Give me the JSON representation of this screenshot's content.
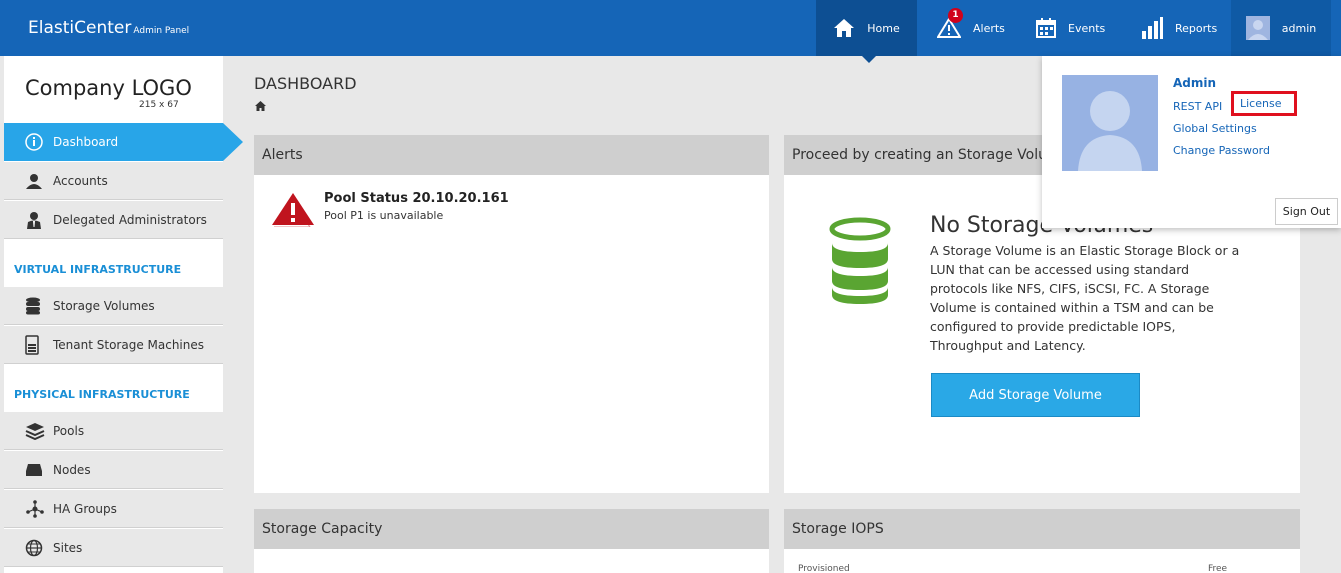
{
  "brand": {
    "name": "ElastiCenter",
    "sub": "Admin Panel"
  },
  "nav": {
    "home": "Home",
    "alerts": "Alerts",
    "alerts_badge": "1",
    "events": "Events",
    "reports": "Reports",
    "user": "admin"
  },
  "sidebar": {
    "logo": "Company LOGO",
    "logo_size": "215 x 67",
    "items": [
      {
        "label": "Dashboard",
        "icon": "info-icon"
      },
      {
        "label": "Accounts",
        "icon": "user-icon"
      },
      {
        "label": "Delegated Administrators",
        "icon": "admin-user-icon"
      }
    ],
    "virtual_section": "VIRTUAL INFRASTRUCTURE",
    "virtual_items": [
      {
        "label": "Storage Volumes",
        "icon": "database-icon"
      },
      {
        "label": "Tenant Storage Machines",
        "icon": "machine-icon"
      }
    ],
    "physical_section": "PHYSICAL INFRASTRUCTURE",
    "physical_items": [
      {
        "label": "Pools",
        "icon": "layers-icon"
      },
      {
        "label": "Nodes",
        "icon": "node-icon"
      },
      {
        "label": "HA Groups",
        "icon": "network-icon"
      },
      {
        "label": "Sites",
        "icon": "globe-icon"
      }
    ]
  },
  "page": {
    "title": "DASHBOARD"
  },
  "alerts_panel": {
    "title": "Alerts",
    "alert_title": "Pool Status 20.10.20.161",
    "alert_sub": "Pool P1 is unavailable"
  },
  "storage_panel": {
    "title": "Proceed by creating an Storage Volume",
    "heading": "No Storage Volumes",
    "description": "A Storage Volume is an Elastic Storage Block or a LUN that can be accessed using standard protocols like NFS, CIFS, iSCSI, FC. A Storage Volume is contained within a TSM and can be configured to provide predictable IOPS, Throughput and Latency.",
    "button": "Add Storage Volume"
  },
  "capacity_panel": {
    "title": "Storage Capacity"
  },
  "iops_panel": {
    "title": "Storage IOPS",
    "provisioned": "Provisioned",
    "free": "Free"
  },
  "user_menu": {
    "name": "Admin",
    "rest_api": "REST API",
    "license": "License",
    "global_settings": "Global Settings",
    "change_password": "Change Password",
    "sign_out": "Sign Out"
  },
  "colors": {
    "topbar": "#1565b7",
    "active": "#28a5e8",
    "section": "#1a8fd6",
    "alert_red": "#c0141e",
    "storage_green": "#5aa532",
    "highlight": "#e0101e"
  }
}
